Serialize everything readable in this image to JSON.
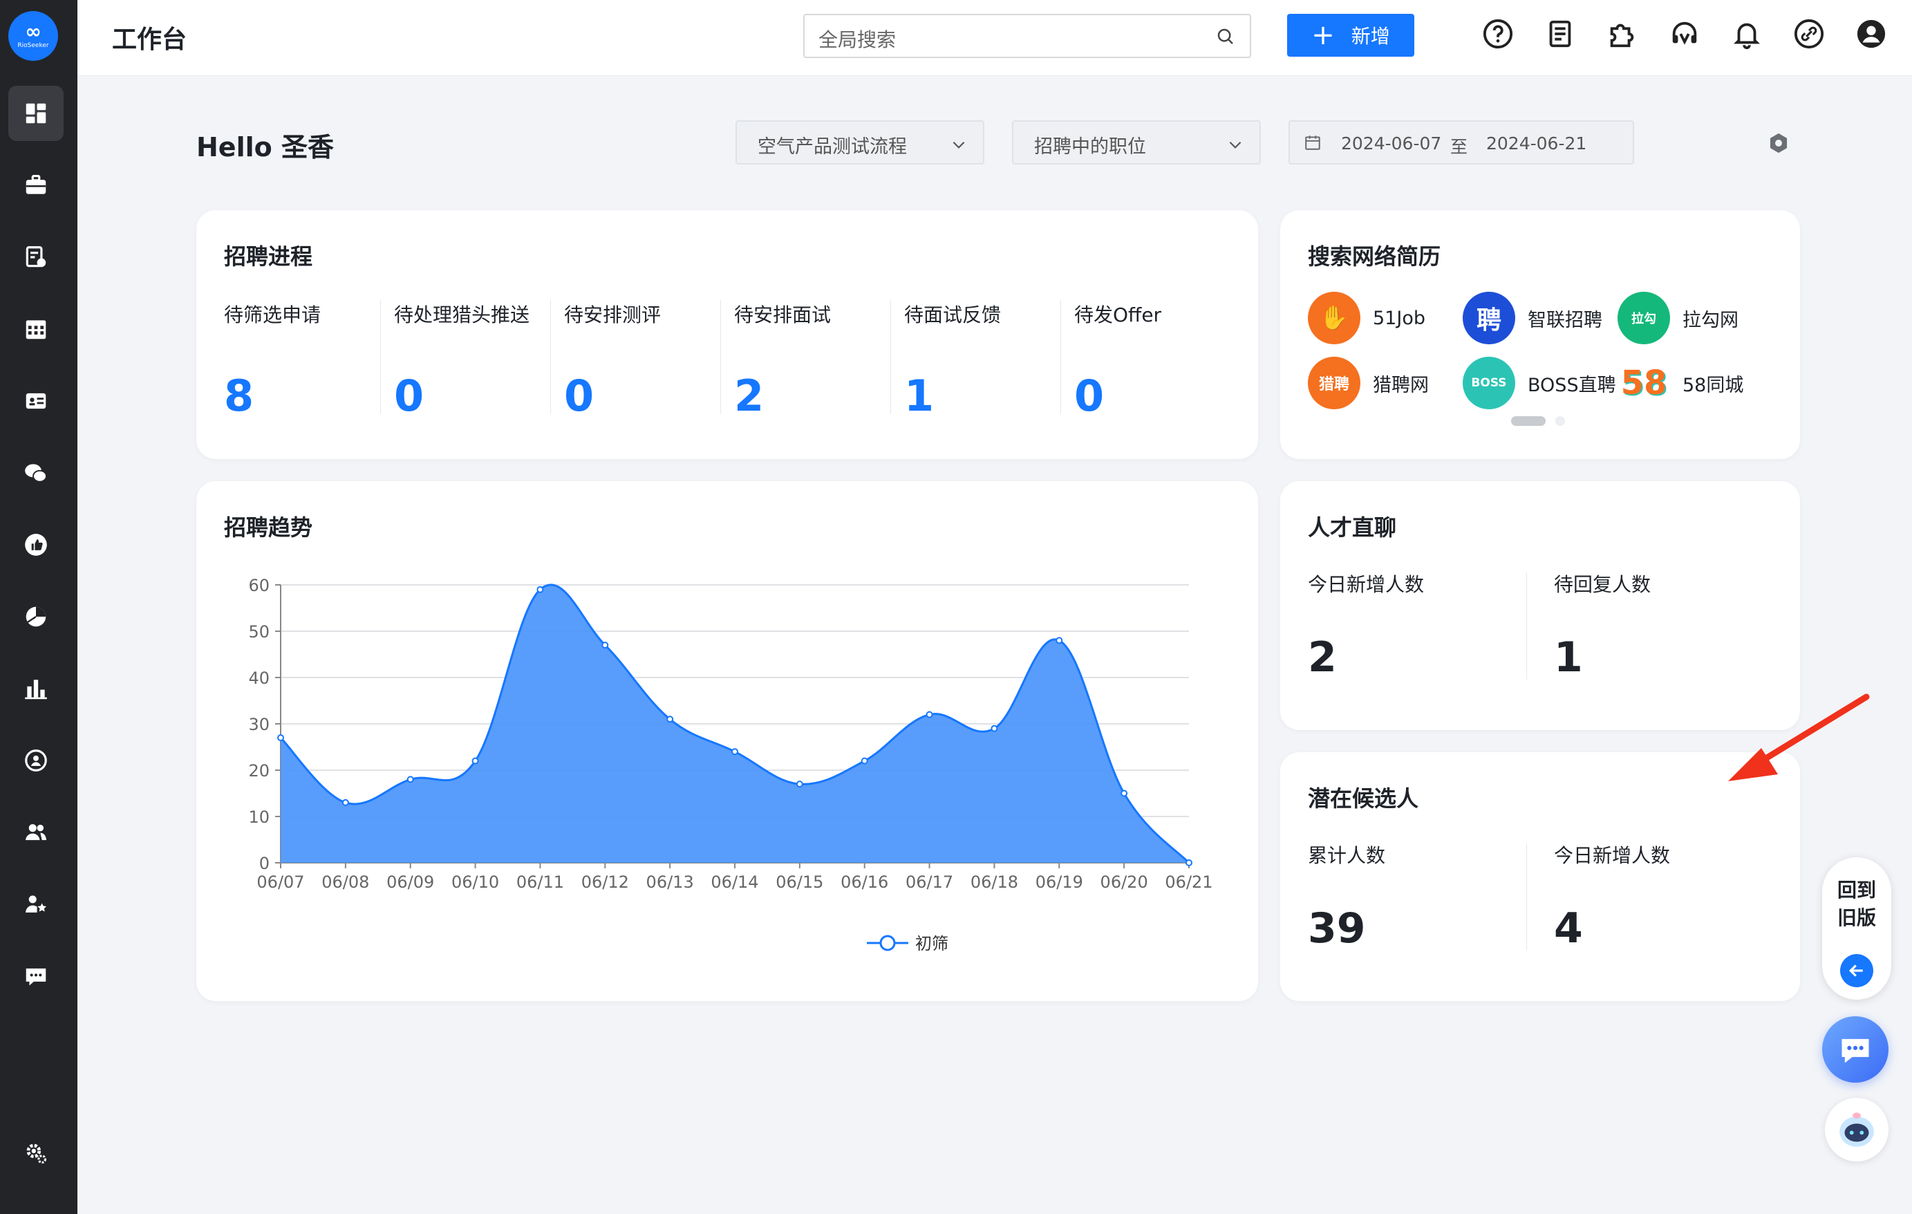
{
  "app": {
    "logo_text": "RioSeeker",
    "logo_mark": "∞"
  },
  "sidebar": {
    "items": [
      {
        "name": "dashboard-icon"
      },
      {
        "name": "briefcase-icon"
      },
      {
        "name": "resume-search-icon"
      },
      {
        "name": "calendar-icon"
      },
      {
        "name": "id-card-icon"
      },
      {
        "name": "wechat-icon"
      },
      {
        "name": "thumbs-up-icon"
      },
      {
        "name": "pie-chart-icon"
      },
      {
        "name": "bar-chart-icon"
      },
      {
        "name": "talent-icon"
      },
      {
        "name": "users-icon"
      },
      {
        "name": "user-star-icon"
      },
      {
        "name": "message-icon"
      },
      {
        "name": "gear-icon"
      }
    ]
  },
  "header": {
    "title": "工作台",
    "search_placeholder": "全局搜索",
    "add_label": "新增",
    "icons": [
      "help-icon",
      "document-icon",
      "puzzle-icon",
      "headset-icon",
      "bell-icon",
      "link-icon",
      "user-avatar-icon"
    ]
  },
  "greeting": "Hello 圣香",
  "filters": {
    "process": "空气产品测试流程",
    "position": "招聘中的职位",
    "date_start": "2024-06-07",
    "date_sep": "至",
    "date_end": "2024-06-21"
  },
  "recruit_process": {
    "title": "招聘进程",
    "stats": [
      {
        "label": "待筛选申请",
        "value": "8"
      },
      {
        "label": "待处理猎头推送",
        "value": "0"
      },
      {
        "label": "待安排测评",
        "value": "0"
      },
      {
        "label": "待安排面试",
        "value": "2"
      },
      {
        "label": "待面试反馈",
        "value": "1"
      },
      {
        "label": "待发Offer",
        "value": "0"
      }
    ]
  },
  "network_resume": {
    "title": "搜索网络简历",
    "sources": [
      {
        "name": "51Job",
        "badge": "✋",
        "color": "#f5701f"
      },
      {
        "name": "智联招聘",
        "badge": "聘",
        "color": "#1d4ed8"
      },
      {
        "name": "拉勾网",
        "badge": "拉勾",
        "color": "#14b87a"
      },
      {
        "name": "猎聘网",
        "badge": "猎聘",
        "color": "#f5701f"
      },
      {
        "name": "BOSS直聘",
        "badge": "BOSS",
        "color": "#2bc4b4"
      },
      {
        "name": "58同城",
        "badge": "58",
        "color": "#ffffff"
      }
    ]
  },
  "talent_chat": {
    "title": "人才直聊",
    "metrics": [
      {
        "label": "今日新增人数",
        "value": "2"
      },
      {
        "label": "待回复人数",
        "value": "1"
      }
    ]
  },
  "potential": {
    "title": "潜在候选人",
    "metrics": [
      {
        "label": "累计人数",
        "value": "39"
      },
      {
        "label": "今日新增人数",
        "value": "4"
      }
    ]
  },
  "trend": {
    "title": "招聘趋势"
  },
  "chart_data": {
    "type": "area",
    "title": "招聘趋势",
    "categories": [
      "06/07",
      "06/08",
      "06/09",
      "06/10",
      "06/11",
      "06/12",
      "06/13",
      "06/14",
      "06/15",
      "06/16",
      "06/17",
      "06/18",
      "06/19",
      "06/20",
      "06/21"
    ],
    "series": [
      {
        "name": "初筛",
        "values": [
          27,
          13,
          18,
          22,
          59,
          47,
          31,
          24,
          17,
          22,
          32,
          29,
          48,
          15,
          0
        ],
        "color": "#1677ff"
      }
    ],
    "y_ticks": [
      "0",
      "10",
      "20",
      "30",
      "40",
      "50",
      "60"
    ],
    "ylim": [
      0,
      60
    ],
    "grid": true,
    "legend_position": "bottom-center"
  },
  "floating": {
    "old_version": "回到旧版",
    "accent": "#1677ff"
  }
}
